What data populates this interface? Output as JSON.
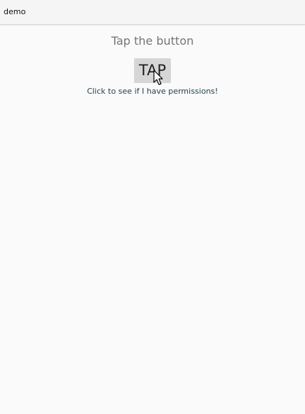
{
  "app_bar": {
    "title": "demo"
  },
  "main": {
    "heading": "Tap the button",
    "tap_button_label": "TAP",
    "hint": "Click to see if I have permissions!"
  },
  "icons": {
    "cursor": "mouse-pointer-icon"
  },
  "colors": {
    "background": "#fafafa",
    "app_bar": "#f5f5f5",
    "button": "#d6d6d6",
    "heading": "#757575",
    "hint": "#1f3f4a"
  }
}
